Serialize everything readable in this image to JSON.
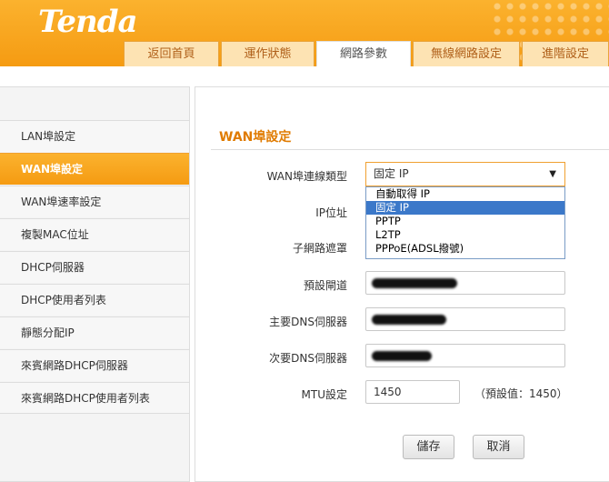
{
  "brand": {
    "logo": "Tenda"
  },
  "nav": {
    "tabs": [
      "返回首頁",
      "運作狀態",
      "網路參數",
      "無線網路設定",
      "進階設定"
    ],
    "active": "網路參數"
  },
  "sidebar": {
    "items": [
      "LAN埠設定",
      "WAN埠設定",
      "WAN埠速率設定",
      "複製MAC位址",
      "DHCP伺服器",
      "DHCP使用者列表",
      "靜態分配IP",
      "來賓網路DHCP伺服器",
      "來賓網路DHCP使用者列表"
    ],
    "active": "WAN埠設定"
  },
  "form": {
    "title": "WAN埠設定",
    "wan_type_label": "WAN埠連線類型",
    "wan_type_value": "固定 IP",
    "wan_type_options": [
      "自動取得 IP",
      "固定 IP",
      "PPTP",
      "L2TP",
      "PPPoE(ADSL撥號)"
    ],
    "ip_label": "IP位址",
    "subnet_label": "子網路遮罩",
    "gateway_label": "預設閘道",
    "dns1_label": "主要DNS伺服器",
    "dns2_label": "次要DNS伺服器",
    "mtu_label": "MTU設定",
    "mtu_value": "1450",
    "mtu_hint": "（預設值：1450）",
    "save_label": "儲存",
    "cancel_label": "取消"
  },
  "colors": {
    "accent": "#f59b12",
    "selected_option": "#3b78c9"
  }
}
